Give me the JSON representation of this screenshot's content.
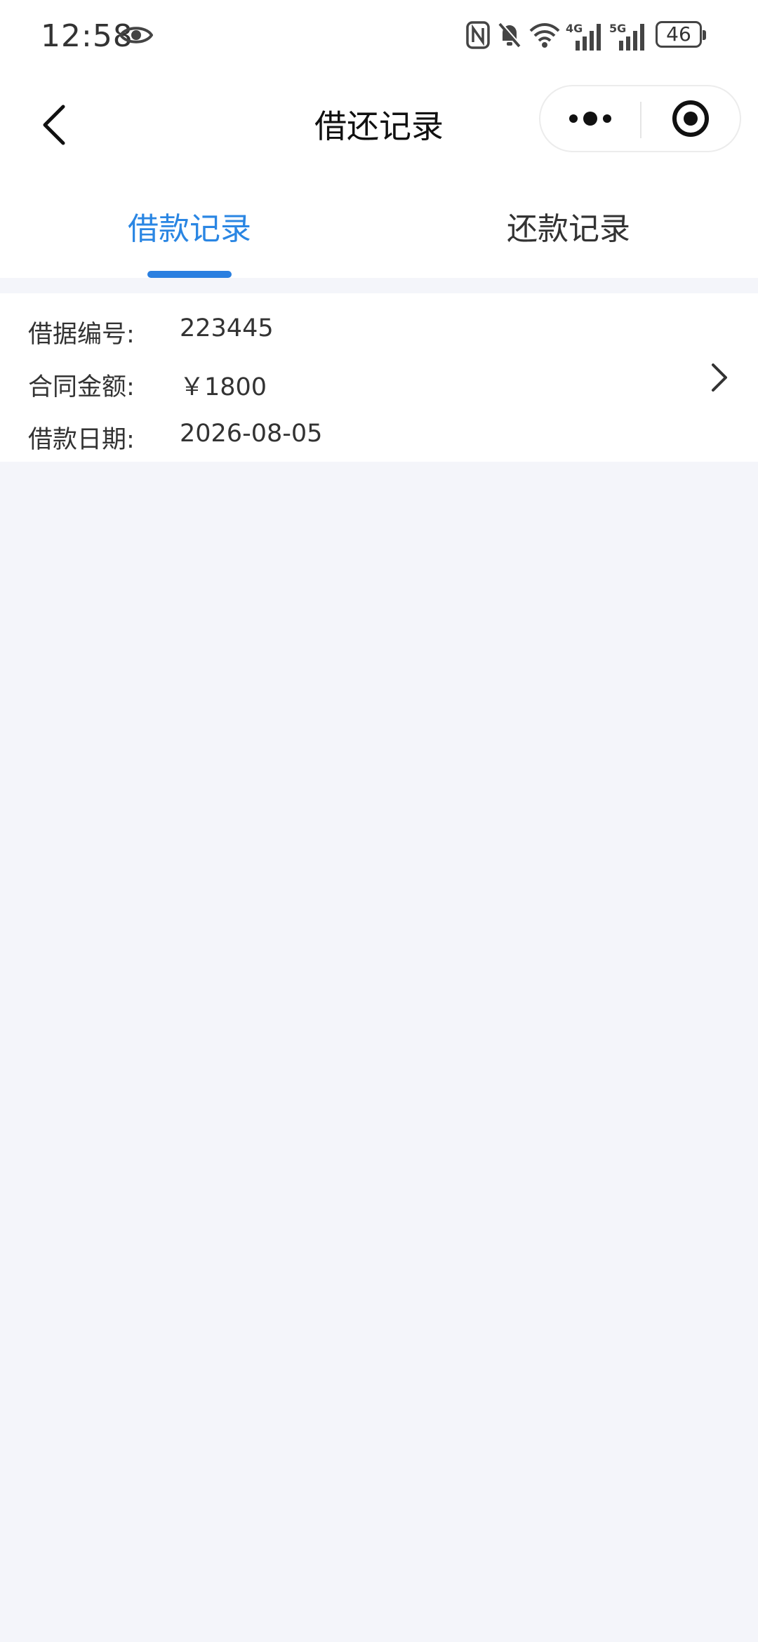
{
  "status_bar": {
    "time": "12:58",
    "battery": "46",
    "network_4g": "4G",
    "network_5g": "5G",
    "icons": [
      "eye-icon",
      "nfc-icon",
      "bell-muted-icon",
      "wifi-icon",
      "signal-icon",
      "signal-icon",
      "battery-icon"
    ]
  },
  "nav": {
    "title": "借还记录"
  },
  "tabs": [
    {
      "label": "借款记录",
      "active": true
    },
    {
      "label": "还款记录",
      "active": false
    }
  ],
  "record": {
    "rows": [
      {
        "label": "借据编号:",
        "value": "223445"
      },
      {
        "label": "合同金额:",
        "value": "￥1800"
      },
      {
        "label": "借款日期:",
        "value": "2026-08-05"
      }
    ]
  },
  "colors": {
    "accent": "#2a86e3",
    "background": "#f4f5fa",
    "text": "#333333"
  }
}
